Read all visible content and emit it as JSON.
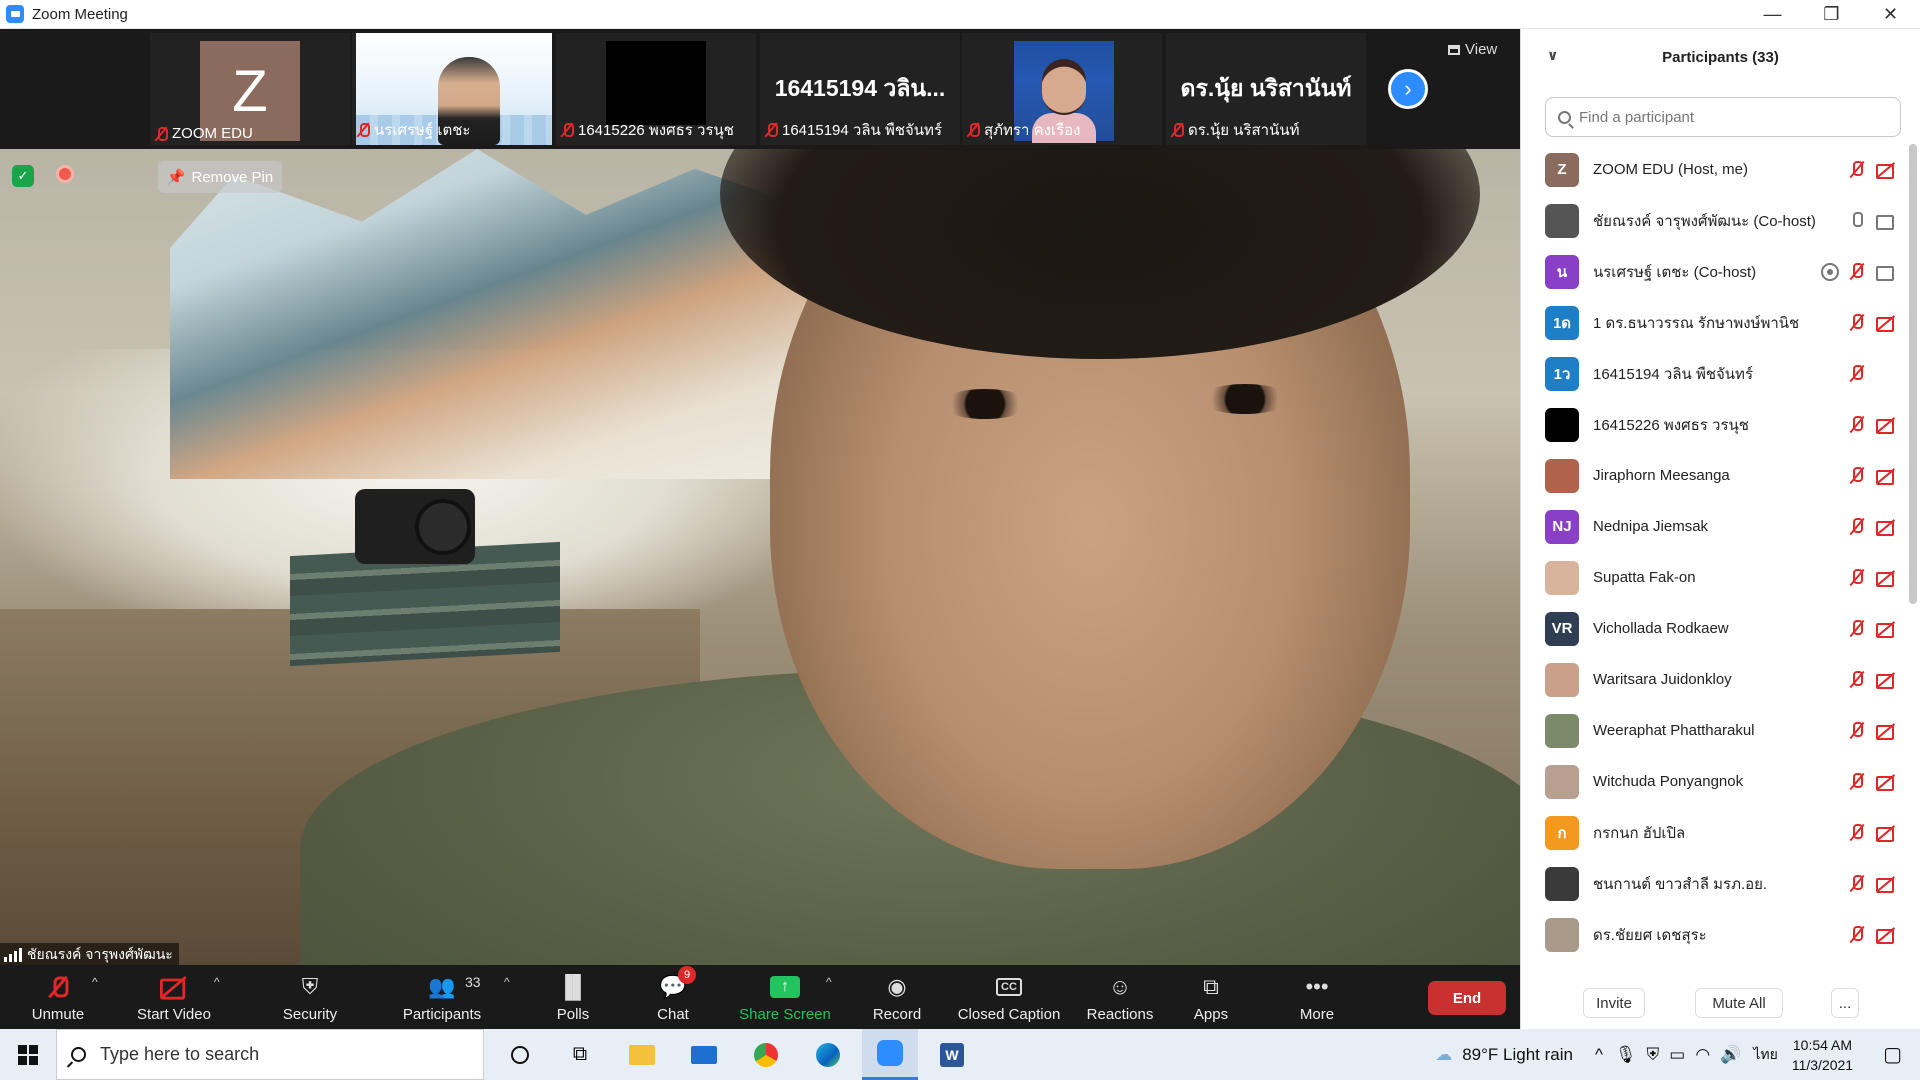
{
  "window": {
    "title": "Zoom Meeting",
    "buttons": [
      "—",
      "❐",
      "✕"
    ]
  },
  "thumbnails": [
    {
      "label": "ZOOM EDU",
      "avatar_letter": "Z",
      "kind": "letter"
    },
    {
      "label": "นรเศรษฐ์ เตชะ",
      "kind": "slide"
    },
    {
      "label": "16415226 พงศธร วรนุช",
      "kind": "black"
    },
    {
      "label": "16415194 วลิน พืชจันทร์",
      "big_name": "16415194 วลิน...",
      "kind": "name"
    },
    {
      "label": "สุภัทรา คงเรือง",
      "kind": "woman"
    },
    {
      "label": "ดร.นุ้ย นริสานันท์",
      "big_name": "ดร.นุ้ย นริสานันท์",
      "kind": "name"
    }
  ],
  "view_button": "View",
  "main": {
    "remove_pin": "Remove Pin",
    "speaker_name": "ชัยณรงค์ จารุพงศ์พัฒนะ"
  },
  "toolbar": {
    "unmute": "Unmute",
    "start_video": "Start Video",
    "security": "Security",
    "participants": "Participants",
    "participants_count": "33",
    "polls": "Polls",
    "chat": "Chat",
    "chat_badge": "9",
    "share_screen": "Share Screen",
    "record": "Record",
    "closed_caption": "Closed Caption",
    "cc_glyph": "CC",
    "reactions": "Reactions",
    "apps": "Apps",
    "more": "More",
    "end": "End",
    "colors": {
      "share_green": "#22c45e",
      "end_red": "#c8312f"
    }
  },
  "panel": {
    "title": "Participants (33)",
    "search_placeholder": "Find a participant",
    "participants": [
      {
        "name": "ZOOM EDU (Host, me)",
        "avatar": "Z",
        "color": "#8b6b5e",
        "mic": "off",
        "video": "off"
      },
      {
        "name": "ชัยณรงค์ จารุพงศ์พัฒนะ (Co-host)",
        "avatar": "",
        "color": "#555555",
        "mic": "on",
        "video": "on"
      },
      {
        "name": "นรเศรษฐ์ เตชะ (Co-host)",
        "avatar": "น",
        "color": "#8a3fc7",
        "mic": "off",
        "video": "on",
        "sharing": true
      },
      {
        "name": "1 ดร.ธนาวรรณ รักษาพงษ์พานิช",
        "avatar": "1ด",
        "color": "#1e7fc7",
        "mic": "off",
        "video": "off"
      },
      {
        "name": "16415194 วลิน พืชจันทร์",
        "avatar": "1ว",
        "color": "#1e7fc7",
        "mic": "off",
        "video": "none"
      },
      {
        "name": "16415226 พงศธร วรนุช",
        "avatar": "",
        "color": "#000000",
        "mic": "off",
        "video": "off"
      },
      {
        "name": "Jiraphorn Meesanga",
        "avatar": "",
        "color": "#b0624a",
        "mic": "off",
        "video": "off"
      },
      {
        "name": "Nednipa Jiemsak",
        "avatar": "NJ",
        "color": "#8a3fc7",
        "mic": "off",
        "video": "off"
      },
      {
        "name": "Supatta Fak-on",
        "avatar": "",
        "color": "#d9b49c",
        "mic": "off",
        "video": "off"
      },
      {
        "name": "Vichollada Rodkaew",
        "avatar": "VR",
        "color": "#2f3e52",
        "mic": "off",
        "video": "off"
      },
      {
        "name": "Waritsara Juidonkloy",
        "avatar": "",
        "color": "#c9a08a",
        "mic": "off",
        "video": "off"
      },
      {
        "name": "Weeraphat Phattharakul",
        "avatar": "",
        "color": "#7a8a6a",
        "mic": "off",
        "video": "off"
      },
      {
        "name": "Witchuda Ponyangnok",
        "avatar": "",
        "color": "#b8a090",
        "mic": "off",
        "video": "off"
      },
      {
        "name": "กรกนก ฮัปเปิล",
        "avatar": "ก",
        "color": "#f39a1e",
        "mic": "off",
        "video": "off"
      },
      {
        "name": "ชนกานต์ ขาวสำลี มรภ.อย.",
        "avatar": "",
        "color": "#3a3a3a",
        "mic": "off",
        "video": "off"
      },
      {
        "name": "ดร.ชัยยศ เดชสุระ",
        "avatar": "",
        "color": "#a99a8a",
        "mic": "off",
        "video": "off"
      }
    ],
    "invite": "Invite",
    "mute_all": "Mute All",
    "more": "..."
  },
  "taskbar": {
    "search_placeholder": "Type here to search",
    "weather": "89°F  Light rain",
    "language": "ไทย",
    "time": "10:54 AM",
    "date": "11/3/2021"
  }
}
